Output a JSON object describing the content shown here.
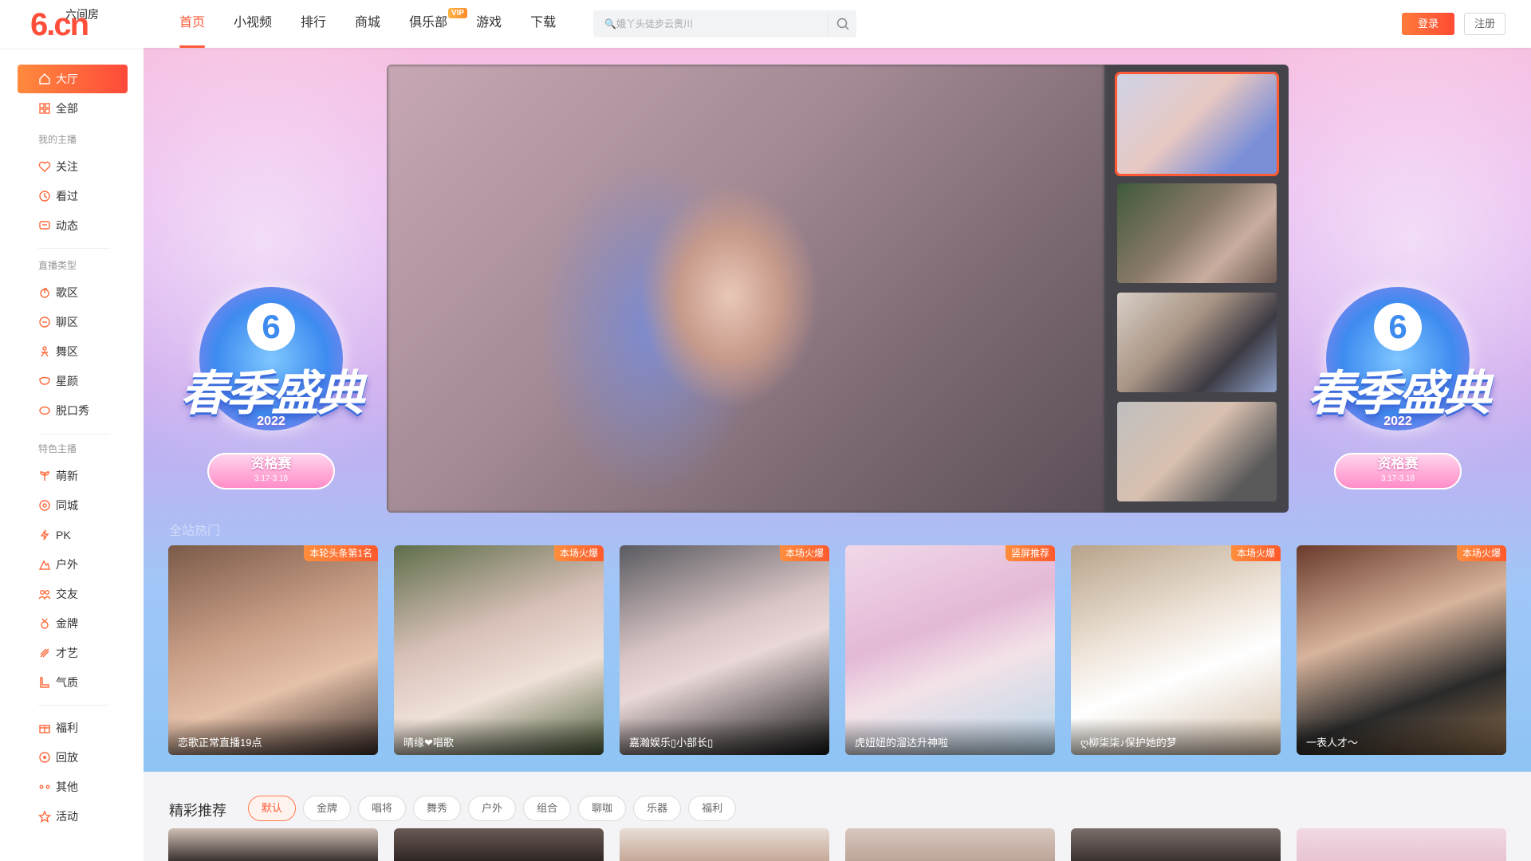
{
  "header": {
    "logo_text": "6.cn",
    "logo_sub": "六间房",
    "nav": [
      {
        "label": "首页"
      },
      {
        "label": "小视频"
      },
      {
        "label": "排行"
      },
      {
        "label": "商城"
      },
      {
        "label": "俱乐部",
        "badge": "VIP"
      },
      {
        "label": "游戏"
      },
      {
        "label": "下载"
      }
    ],
    "search_placeholder": "🔍娥丫头徒步云贵川",
    "login": "登录",
    "register": "注册"
  },
  "sidebar": {
    "top": [
      {
        "label": "大厅",
        "icon": "home-icon",
        "active": true
      },
      {
        "label": "全部",
        "icon": "grid-icon"
      }
    ],
    "group1": "我的主播",
    "my": [
      {
        "label": "关注",
        "icon": "heart-icon"
      },
      {
        "label": "看过",
        "icon": "clock-icon"
      },
      {
        "label": "动态",
        "icon": "message-icon"
      }
    ],
    "group2": "直播类型",
    "types": [
      {
        "label": "歌区",
        "icon": "music-icon"
      },
      {
        "label": "聊区",
        "icon": "chat-icon"
      },
      {
        "label": "舞区",
        "icon": "dance-icon"
      },
      {
        "label": "星颜",
        "icon": "mask-icon"
      },
      {
        "label": "脱口秀",
        "icon": "talk-icon"
      }
    ],
    "group3": "特色主播",
    "special": [
      {
        "label": "萌新",
        "icon": "sprout-icon"
      },
      {
        "label": "同城",
        "icon": "location-icon"
      },
      {
        "label": "PK",
        "icon": "lightning-icon"
      },
      {
        "label": "户外",
        "icon": "mountain-icon"
      },
      {
        "label": "交友",
        "icon": "friends-icon"
      },
      {
        "label": "金牌",
        "icon": "medal-icon"
      },
      {
        "label": "才艺",
        "icon": "palette-icon"
      },
      {
        "label": "气质",
        "icon": "boot-icon"
      }
    ],
    "more": [
      {
        "label": "福利",
        "icon": "gift-icon"
      },
      {
        "label": "回放",
        "icon": "replay-icon"
      },
      {
        "label": "其他",
        "icon": "more-icon"
      },
      {
        "label": "活动",
        "icon": "star-icon"
      }
    ]
  },
  "banner": {
    "emblem_title": "春季盛典",
    "emblem_year": "2022",
    "emblem_stage": "资格赛",
    "emblem_dates": "3.17-3.18"
  },
  "hot": {
    "title": "全站热门",
    "cards": [
      {
        "tag": "本轮头条第1名",
        "caption": "恋歌正常直播19点"
      },
      {
        "tag": "本场火爆",
        "caption": "晴缘❤唱歌"
      },
      {
        "tag": "本场火爆",
        "caption": "嘉瀚娱乐▯小部长▯"
      },
      {
        "tag": "竖屏推荐",
        "caption": "虎妞妞的溜达升神啦"
      },
      {
        "tag": "本场火爆",
        "caption": "ღ柳柒柒♪保护她的梦"
      },
      {
        "tag": "本场火爆",
        "caption": "一表人才～"
      }
    ]
  },
  "recommend": {
    "title": "精彩推荐",
    "tabs": [
      "默认",
      "金牌",
      "唱将",
      "舞秀",
      "户外",
      "组合",
      "聊咖",
      "乐器",
      "福利"
    ]
  },
  "colors": {
    "accent": "#ff5a36",
    "tag": "#ff6a2d"
  }
}
